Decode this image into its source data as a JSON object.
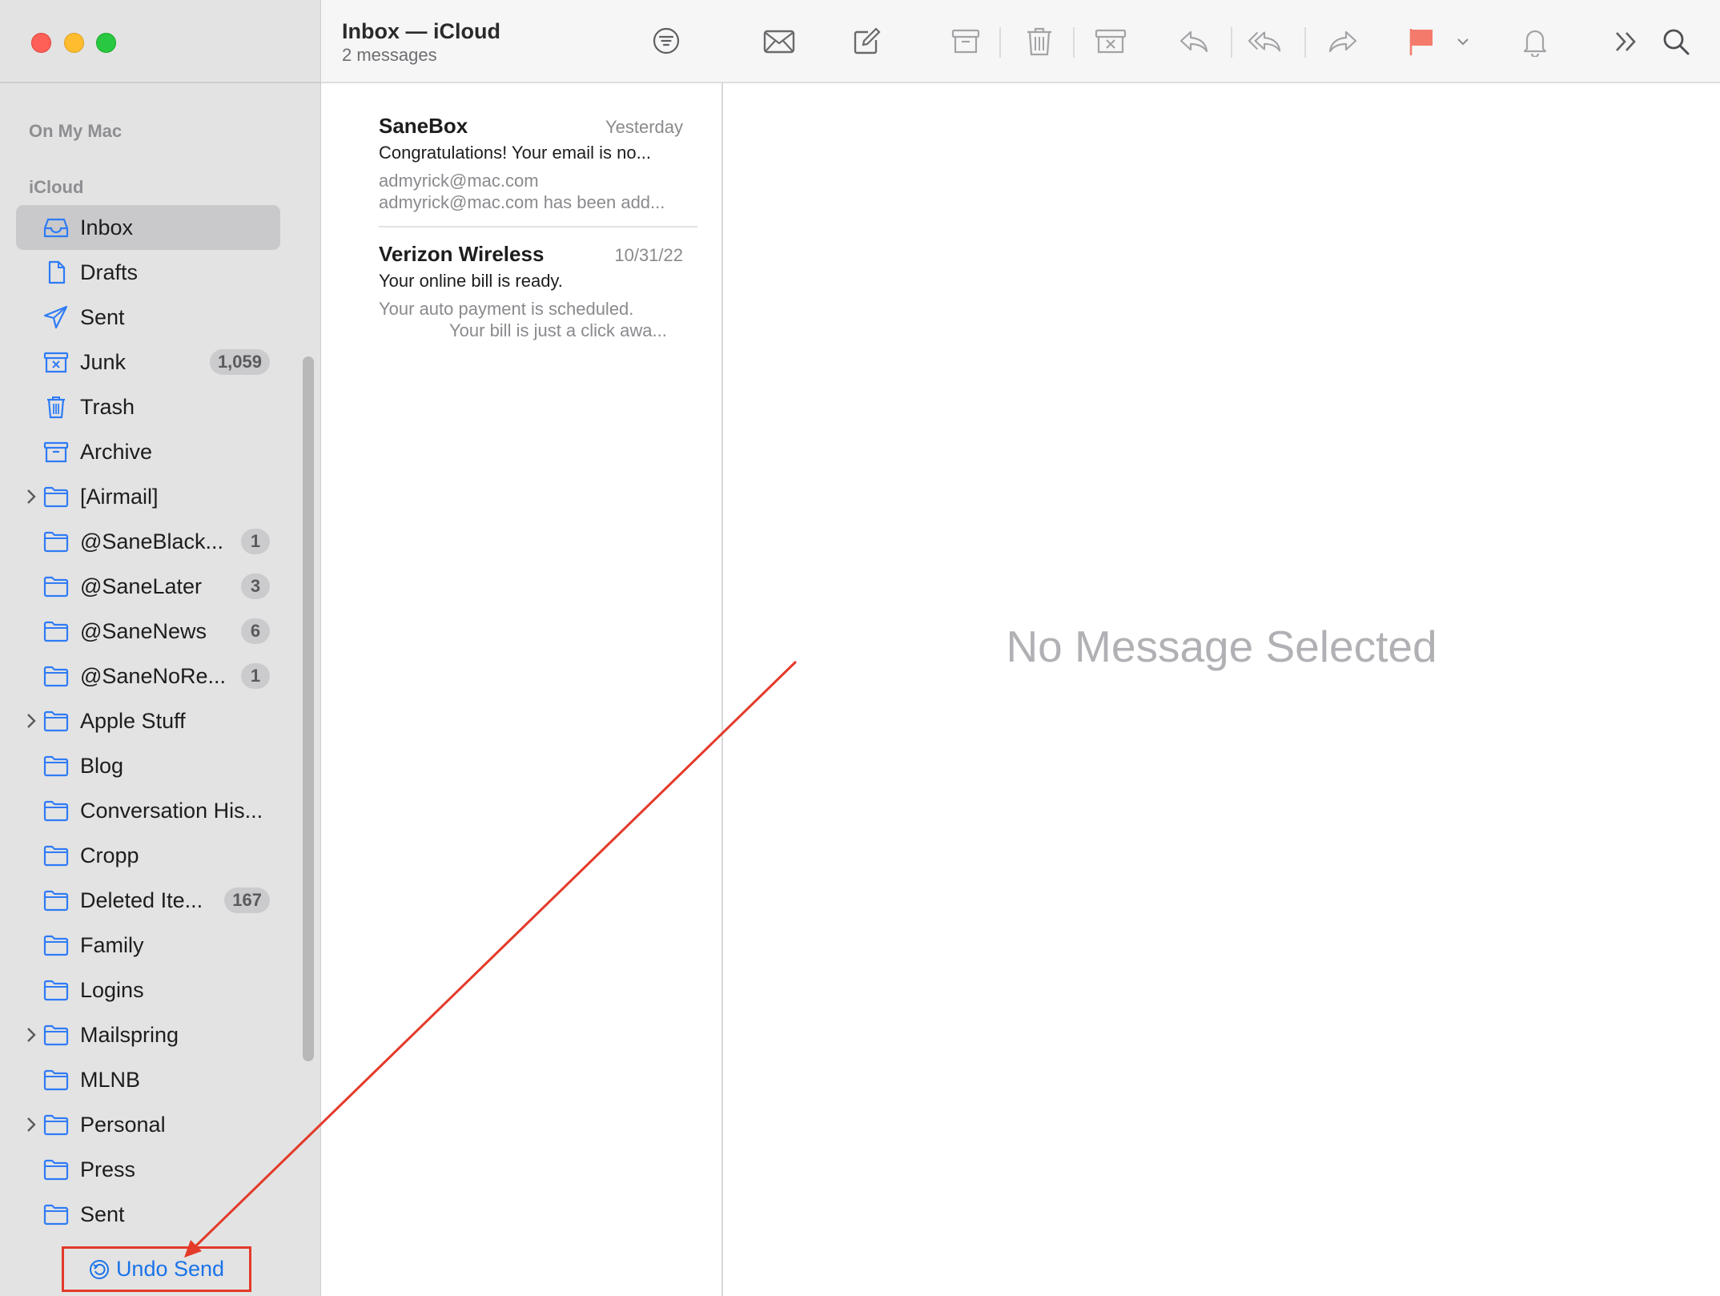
{
  "sidebar": {
    "section_on_my_mac": "On My Mac",
    "section_icloud": "iCloud",
    "folders": [
      {
        "label": "Inbox",
        "icon": "inbox-icon",
        "selected": true
      },
      {
        "label": "Drafts",
        "icon": "document-icon"
      },
      {
        "label": "Sent",
        "icon": "paper-plane-icon"
      },
      {
        "label": "Junk",
        "icon": "junk-icon",
        "badge": "1,059"
      },
      {
        "label": "Trash",
        "icon": "trash-icon"
      },
      {
        "label": "Archive",
        "icon": "archive-icon"
      },
      {
        "label": "[Airmail]",
        "icon": "folder-icon",
        "expandable": true
      },
      {
        "label": "@SaneBlack...",
        "icon": "folder-icon",
        "badge": "1"
      },
      {
        "label": "@SaneLater",
        "icon": "folder-icon",
        "badge": "3"
      },
      {
        "label": "@SaneNews",
        "icon": "folder-icon",
        "badge": "6"
      },
      {
        "label": "@SaneNoRe...",
        "icon": "folder-icon",
        "badge": "1"
      },
      {
        "label": "Apple Stuff",
        "icon": "folder-icon",
        "expandable": true
      },
      {
        "label": "Blog",
        "icon": "folder-icon"
      },
      {
        "label": "Conversation His...",
        "icon": "folder-icon"
      },
      {
        "label": "Cropp",
        "icon": "folder-icon"
      },
      {
        "label": "Deleted Ite...",
        "icon": "folder-icon",
        "badge": "167"
      },
      {
        "label": "Family",
        "icon": "folder-icon"
      },
      {
        "label": "Logins",
        "icon": "folder-icon"
      },
      {
        "label": "Mailspring",
        "icon": "folder-icon",
        "expandable": true
      },
      {
        "label": "MLNB",
        "icon": "folder-icon"
      },
      {
        "label": "Personal",
        "icon": "folder-icon",
        "expandable": true
      },
      {
        "label": "Press",
        "icon": "folder-icon"
      },
      {
        "label": "Sent",
        "icon": "folder-icon"
      }
    ],
    "undo_send_label": "Undo Send"
  },
  "mailbox": {
    "title": "Inbox — iCloud",
    "subtitle": "2 messages",
    "messages": [
      {
        "sender": "SaneBox",
        "date": "Yesterday",
        "subject": "Congratulations! Your email is no...",
        "preview1": "admyrick@mac.com",
        "preview2": "admyrick@mac.com has been add..."
      },
      {
        "sender": "Verizon Wireless",
        "date": "10/31/22",
        "subject": "Your online bill is ready.",
        "preview1": "Your auto payment is scheduled.",
        "preview2": "Your bill is just a click awa..."
      }
    ]
  },
  "toolbar": {
    "icons": [
      "get-mail-icon",
      "compose-icon",
      "archive-icon",
      "delete-icon",
      "junk-icon",
      "reply-icon",
      "reply-all-icon",
      "forward-icon",
      "flag-icon",
      "flag-menu-chevron-icon",
      "mute-bell-icon",
      "more-chevron-icon",
      "search-icon"
    ]
  },
  "viewer": {
    "empty_text": "No Message Selected"
  },
  "colors": {
    "accent_blue": "#1a73e8",
    "annotation_red": "#e33a2a",
    "flag_red": "#f47a6b",
    "folder_icon_blue": "#2f7bf5"
  }
}
